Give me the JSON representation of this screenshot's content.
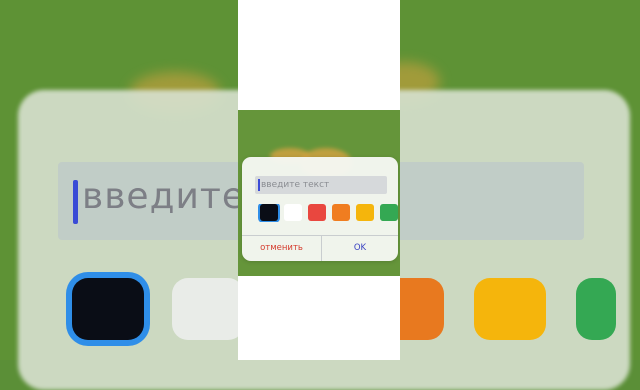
{
  "dialog": {
    "input_placeholder": "введите текст",
    "cancel_label": "отменить",
    "ok_label": "OK",
    "selected_color": "#0a0d16",
    "colors": [
      "#0a0d16",
      "#ffffff",
      "#e9473f",
      "#f07d20",
      "#f5b50c",
      "#34a853"
    ]
  },
  "background": {
    "placeholder_fragment": "введите т",
    "scene_color": "#65953a"
  }
}
